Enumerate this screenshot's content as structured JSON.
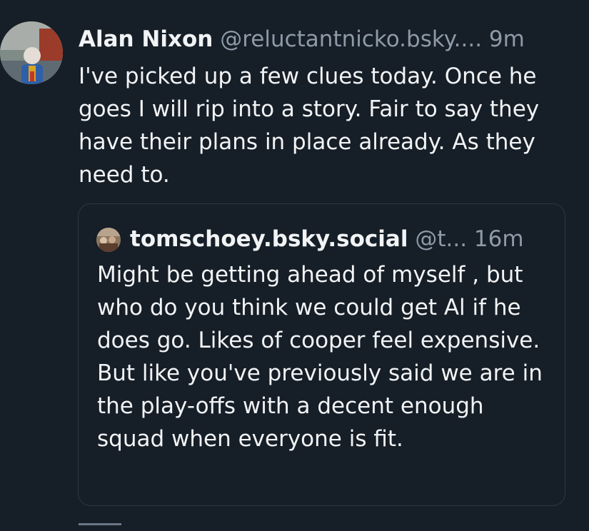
{
  "post": {
    "author_name": "Alan Nixon",
    "author_handle": "@reluctantnicko.bsky....",
    "time": "9m",
    "text": "I've picked up a few clues today. Once he goes I will rip into a story. Fair to say they have their plans in place already. As they need to."
  },
  "quote": {
    "author_name": "tomschoey.bsky.social",
    "author_handle": "@t...",
    "time": "16m",
    "text": "Might be getting ahead of myself , but who do you think we could get Al if he does go. Likes of cooper feel expensive. But like you've previously said we are in the play-offs with a decent enough squad when everyone is fit."
  }
}
